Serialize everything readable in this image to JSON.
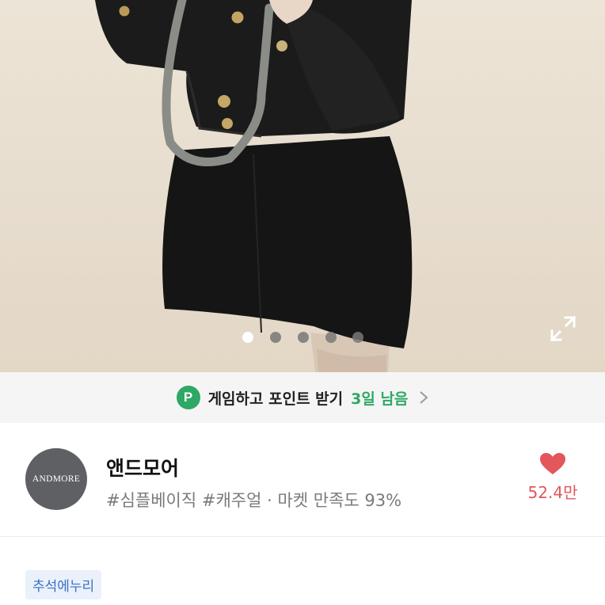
{
  "photo": {
    "slide_count": 5,
    "active_index": 0,
    "expand_icon": "expand-arrows-icon"
  },
  "banner": {
    "badge": "P",
    "text": "게임하고 포인트 받기",
    "days_left": "3일 남음",
    "chevron_icon": "chevron-right-icon",
    "accent_color": "#2ea865"
  },
  "shop": {
    "avatar_text": "ANDMORE",
    "name": "앤드모어",
    "tags": "#심플베이직 #캐주얼 · 마켓 만족도 93%",
    "like_icon": "heart-icon",
    "like_count": "52.4만",
    "like_color": "#e2565c"
  },
  "chip": {
    "label": "추석에누리"
  }
}
